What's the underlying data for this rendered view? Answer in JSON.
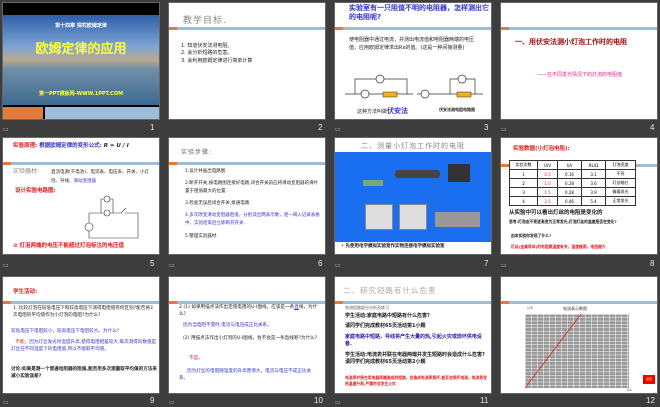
{
  "slides": [
    {
      "n": "1",
      "chapter": "第十四章  探究欧姆定律",
      "title": "欧姆定律的应用",
      "site": "第一PPT模板网-WWW.1PPT.COM"
    },
    {
      "n": "2",
      "title": "教学目标.",
      "items": [
        "1. 知道伏安法测电阻。",
        "2. 会分析短路的危害。",
        "3. 会利用欧姆定律进行简单计算"
      ]
    },
    {
      "n": "3",
      "title": "实验室有一只阻值不明的电阻器，怎样测出它的电阻呢?",
      "body": "使电阻器中通过电流，并测出电流值和电阻器两端的电压值，应用欧姆定律求出Rx的值。(这是一种间接测量)",
      "method_prefix": "这种方法叫做",
      "method": "伏安法",
      "caption": "伏安法测电阻电路图",
      "rx": "Rx"
    },
    {
      "n": "4",
      "heading": "一、用伏安法测小灯泡工作时的电阻",
      "sub": "——在不同发光情况下的灯泡的电阻值"
    },
    {
      "n": "5",
      "principle_label": "实验原理:",
      "principle": "根据欧姆定律的变形公式:",
      "formula": "R = U / I",
      "equip_label": "实验器材:",
      "equip": "直流电源(干电池)、电流表、电压表、开关、小灯泡、导线、",
      "equip_hl": "滑动变阻器",
      "design": "设计实验电路图:",
      "warning": "灯泡两端的电压不能超过灯泡标注的电压值"
    },
    {
      "n": "6",
      "title": "实验步骤:",
      "steps": [
        "1.设计并画出电路图.",
        "2.断开开关,按电路图连接好电路,闭合开关前应将滑动变阻器的滑片置于阻值最大的位置.",
        "3.检查无误后闭合开关,接通电路.",
        "4.多次改变滑动变阻器阻值，分别读出两表示数，逐一填入记录表格中，实验结束后立即断开开关.",
        "5.整理实验器材."
      ]
    },
    {
      "n": "7",
      "title": "二、测量小灯泡工作时的电阻",
      "note": "先使用电学模拟实验室作实物连接电学模拟实验室"
    },
    {
      "n": "8",
      "title": "实验数据(小灯泡电阻):",
      "headers": [
        "实验次数",
        "U/V",
        "I/A",
        "RL/Ω",
        "灯泡亮度"
      ],
      "rows": [
        [
          "1",
          "0.5",
          "0.16",
          "3.1",
          "不亮"
        ],
        [
          "2",
          "1.0",
          "0.28",
          "3.6",
          "灯丝暗红"
        ],
        [
          "3",
          "1.5",
          "0.28",
          "3.9",
          "微弱发光"
        ],
        [
          "4",
          "2.5",
          "0.46",
          "5.4",
          "正常发光"
        ]
      ],
      "conclusion": "从实验中可以看出灯丝的电阻是",
      "conclusion_end": "变化的",
      "q1": "思考:灯泡由不亮逐渐变为正常发光,灯泡灯丝的温度是否在变化?",
      "q2": "由本实验你发现了什么?",
      "answer": "灯丝(金属导体)的电阻跟温度有关，温度越高，电阻越大"
    },
    {
      "n": "9",
      "title": "学生活动:",
      "q": "1. 比较灯泡在较低电压下和较高电压下测得电阻值有何区别?能否将3次电阻的平均值作为小灯泡的电阻?为什么?",
      "a1": "较低电压下电阻较小，较高电压下电阻较大。为什么?",
      "no": "不能。",
      "a2": "因为灯丝发光时温度升高,使得电阻相差较大,每次测得的数值是灯丝在不同温度下的电阻值,所以不能取平均值。",
      "discuss": "讨论:如果是测一个普通电阻器的阻值,能否用多次测量取平均值的方法来减小实验误差?"
    },
    {
      "n": "10",
      "q1a": "2.(1) 如果用描点法作出定值电阻的U-I图线，应该是一条",
      "q1blank": "直",
      "q1b": "线，为什么?",
      "a1": "因为当电阻不变时,电流与电压成正比关系。",
      "q2": "(2) 用描点法作出小灯泡的U-I图线，会不会是一条直线呢?为什么?",
      "no": "不是。",
      "a2": "因为灯丝的电阻随温度的升高而增大，电流与电压不成正比关系。"
    },
    {
      "n": "11",
      "title": "二、研究短路有什么危害",
      "sub": "电流短路部分分析及练习",
      "p1": "学生活动:家庭电路中短路有什么危害?",
      "p2": "请同学们完成教材65页活动第1小题",
      "p3": "家庭电路中短路，导线将产生大量的热,引起火灾或烧坏供电设备.",
      "p4": "学生活动:电流表并联在电器两端并发生短路时会造成什么危害?请同学们完成教材65页活动第2小题",
      "p5": "电流表并接在用电器两端造成的短路，会造成电流表损坏,甚至会损坏电源。电流表发热温度升高,严重时会发生火灾"
    },
    {
      "n": "12",
      "chart_title": "电流表示数图",
      "ylabel": "U/V",
      "xlabel": "I/A",
      "btn": "返回"
    }
  ]
}
